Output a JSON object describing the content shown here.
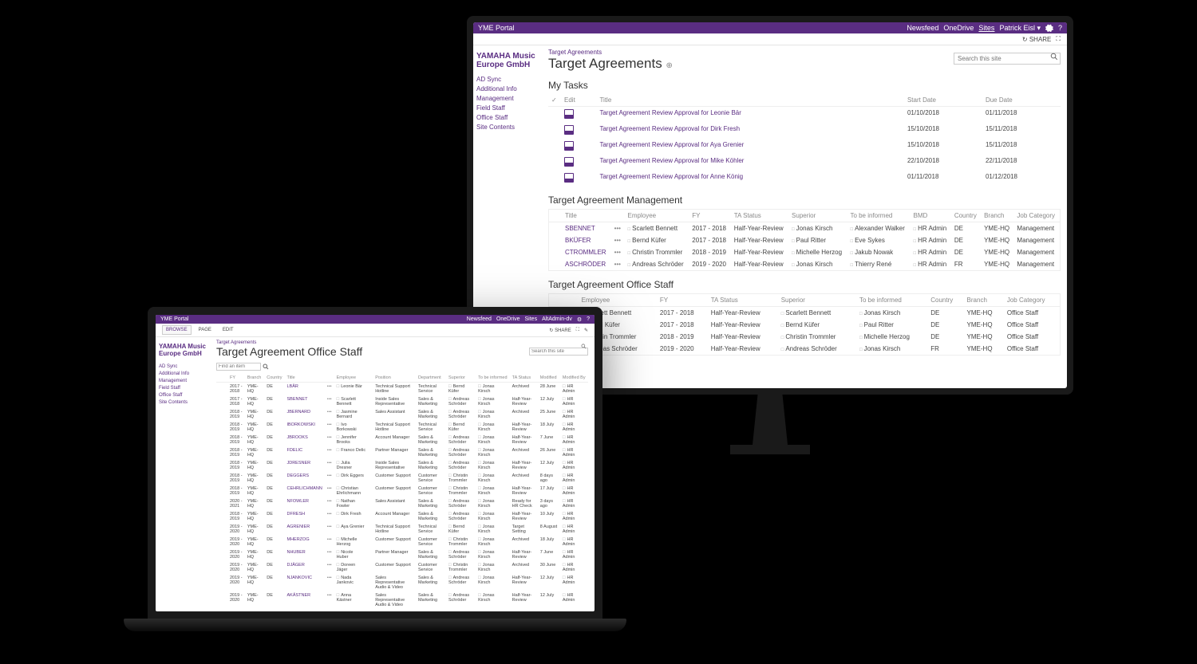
{
  "suite": {
    "brand": "YME Portal",
    "links": [
      "Newsfeed",
      "OneDrive",
      "Sites"
    ],
    "user": "Patrick Eisl",
    "share": "SHARE"
  },
  "ribbon": {
    "browse": "BROWSE",
    "page": "PAGE",
    "edit": "EDIT",
    "altuser": "AltAdmin-dv"
  },
  "logo": {
    "l1": "YAMAHA Music",
    "l2": "Europe GmbH"
  },
  "nav": [
    "AD Sync",
    "Additional Info",
    "Management",
    "Field Staff",
    "Office Staff",
    "Site Contents"
  ],
  "search": {
    "placeholder": "Search this site"
  },
  "monitor": {
    "breadcrumb": "Target Agreements",
    "title": "Target Agreements",
    "myTasks": {
      "heading": "My Tasks",
      "cols": [
        "",
        "Edit",
        "Title",
        "Start Date",
        "Due Date"
      ],
      "rows": [
        {
          "t": "Target Agreement Review Approval for Leonie Bär",
          "s": "01/10/2018",
          "d": "01/11/2018"
        },
        {
          "t": "Target Agreement Review Approval for Dirk Fresh",
          "s": "15/10/2018",
          "d": "15/11/2018"
        },
        {
          "t": "Target Agreement Review Approval for Aya Grenier",
          "s": "15/10/2018",
          "d": "15/11/2018"
        },
        {
          "t": "Target Agreement Review Approval for Mike Köhler",
          "s": "22/10/2018",
          "d": "22/11/2018"
        },
        {
          "t": "Target Agreement Review Approval for Anne König",
          "s": "01/11/2018",
          "d": "01/12/2018"
        }
      ]
    },
    "mgmt": {
      "heading": "Target Agreement Management",
      "cols": [
        "",
        "Title",
        "",
        "Employee",
        "FY",
        "TA Status",
        "Superior",
        "To be informed",
        "BMD",
        "Country",
        "Branch",
        "Job Category"
      ],
      "rows": [
        {
          "ti": "SBENNET",
          "emp": "Scarlett Bennett",
          "fy": "2017 - 2018",
          "st": "Half-Year-Review",
          "sup": "Jonas Kirsch",
          "inf": "Alexander Walker",
          "bmd": "HR Admin",
          "co": "DE",
          "br": "YME-HQ",
          "jc": "Management"
        },
        {
          "ti": "BKÜFER",
          "emp": "Bernd Küfer",
          "fy": "2017 - 2018",
          "st": "Half-Year-Review",
          "sup": "Paul Ritter",
          "inf": "Eve Sykes",
          "bmd": "HR Admin",
          "co": "DE",
          "br": "YME-HQ",
          "jc": "Management"
        },
        {
          "ti": "CTROMMLER",
          "emp": "Christin Trommler",
          "fy": "2018 - 2019",
          "st": "Half-Year-Review",
          "sup": "Michelle Herzog",
          "inf": "Jakub Nowak",
          "bmd": "HR Admin",
          "co": "DE",
          "br": "YME-HQ",
          "jc": "Management"
        },
        {
          "ti": "ASCHRÖDER",
          "emp": "Andreas Schröder",
          "fy": "2019 - 2020",
          "st": "Half-Year-Review",
          "sup": "Jonas Kirsch",
          "inf": "Thierry René",
          "bmd": "HR Admin",
          "co": "FR",
          "br": "YME-HQ",
          "jc": "Management"
        }
      ]
    },
    "office": {
      "heading": "Target Agreement Office Staff",
      "cols": [
        "",
        "",
        "Employee",
        "FY",
        "TA Status",
        "Superior",
        "To be informed",
        "Country",
        "Branch",
        "Job Category"
      ],
      "rows": [
        {
          "emp": "Scarlett Bennett",
          "fy": "2017 - 2018",
          "st": "Half-Year-Review",
          "sup": "Scarlett Bennett",
          "inf": "Jonas Kirsch",
          "co": "DE",
          "br": "YME-HQ",
          "jc": "Office Staff"
        },
        {
          "emp": "Bernd Küfer",
          "fy": "2017 - 2018",
          "st": "Half-Year-Review",
          "sup": "Bernd Küfer",
          "inf": "Paul Ritter",
          "co": "DE",
          "br": "YME-HQ",
          "jc": "Office Staff"
        },
        {
          "emp": "Christin Trommler",
          "fy": "2018 - 2019",
          "st": "Half-Year-Review",
          "sup": "Christin Trommler",
          "inf": "Michelle Herzog",
          "co": "DE",
          "br": "YME-HQ",
          "jc": "Office Staff"
        },
        {
          "emp": "Andreas Schröder",
          "fy": "2019 - 2020",
          "st": "Half-Year-Review",
          "sup": "Andreas Schröder",
          "inf": "Jonas Kirsch",
          "co": "FR",
          "br": "YME-HQ",
          "jc": "Office Staff"
        }
      ]
    }
  },
  "laptop": {
    "breadcrumb": "Target Agreements",
    "title": "Target Agreement Office Staff",
    "findPlaceholder": "Find an item",
    "cols": [
      "",
      "FY",
      "Branch",
      "Country",
      "Title",
      "",
      "Employee",
      "",
      "Position",
      "Department",
      "Superior",
      "To be informed",
      "TA Status",
      "Modified",
      "Modified By"
    ],
    "rows": [
      {
        "fy": "2017 - 2018",
        "br": "YME-HQ",
        "co": "DE",
        "ti": "LBÄR",
        "emp": "Leonie Bär",
        "pos": "Technical Support Hotline",
        "dep": "Technical Service",
        "sup": "Bernd Küfer",
        "inf": "Jonas Kirsch",
        "st": "Archived",
        "mod": "28 June",
        "mby": "HR Admin"
      },
      {
        "fy": "2017 - 2018",
        "br": "YME-HQ",
        "co": "DE",
        "ti": "SBENNET",
        "emp": "Scarlett Bennett",
        "pos": "Inside Sales Representative",
        "dep": "Sales & Marketing",
        "sup": "Andreas Schröder",
        "inf": "Jonas Kirsch",
        "st": "Half-Year-Review",
        "mod": "12 July",
        "mby": "HR Admin"
      },
      {
        "fy": "2018 - 2019",
        "br": "YME-HQ",
        "co": "DE",
        "ti": "JBERNARD",
        "emp": "Jasmine Bernard",
        "pos": "Sales Assistant",
        "dep": "Sales & Marketing",
        "sup": "Andreas Schröder",
        "inf": "Jonas Kirsch",
        "st": "Archived",
        "mod": "25 June",
        "mby": "HR Admin"
      },
      {
        "fy": "2018 - 2019",
        "br": "YME-HQ",
        "co": "DE",
        "ti": "IBORKOWSKI",
        "emp": "Ivo Borkowski",
        "pos": "Technical Support Hotline",
        "dep": "Technical Service",
        "sup": "Bernd Küfer",
        "inf": "Jonas Kirsch",
        "st": "Half-Year-Review",
        "mod": "18 July",
        "mby": "HR Admin"
      },
      {
        "fy": "2018 - 2019",
        "br": "YME-HQ",
        "co": "DE",
        "ti": "JBROOKS",
        "emp": "Jennifer Brooks",
        "pos": "Account Manager",
        "dep": "Sales & Marketing",
        "sup": "Andreas Schröder",
        "inf": "Jonas Kirsch",
        "st": "Half-Year-Review",
        "mod": "7 June",
        "mby": "HR Admin"
      },
      {
        "fy": "2018 - 2019",
        "br": "YME-HQ",
        "co": "DE",
        "ti": "FDELIC",
        "emp": "Franco Delic",
        "pos": "Partner Manager",
        "dep": "Sales & Marketing",
        "sup": "Andreas Schröder",
        "inf": "Jonas Kirsch",
        "st": "Archived",
        "mod": "26 June",
        "mby": "HR Admin"
      },
      {
        "fy": "2018 - 2019",
        "br": "YME-HQ",
        "co": "DE",
        "ti": "JDRESNER",
        "emp": "Julia Dresner",
        "pos": "Inside Sales Representative",
        "dep": "Sales & Marketing",
        "sup": "Andreas Schröder",
        "inf": "Jonas Kirsch",
        "st": "Half-Year-Review",
        "mod": "12 July",
        "mby": "HR Admin"
      },
      {
        "fy": "2018 - 2019",
        "br": "YME-HQ",
        "co": "DE",
        "ti": "DEGGERS",
        "emp": "Dirk Eggers",
        "pos": "Customer Support",
        "dep": "Customer Service",
        "sup": "Christin Trommler",
        "inf": "Jonas Kirsch",
        "st": "Archived",
        "mod": "8 days ago",
        "mby": "HR Admin"
      },
      {
        "fy": "2018 - 2019",
        "br": "YME-HQ",
        "co": "DE",
        "ti": "CEHRLICHMANN",
        "emp": "Christian Ehrlichmann",
        "pos": "Customer Support",
        "dep": "Customer Service",
        "sup": "Christin Trommler",
        "inf": "Jonas Kirsch",
        "st": "Half-Year-Review",
        "mod": "17 July",
        "mby": "HR Admin"
      },
      {
        "fy": "2020 - 2021",
        "br": "YME-HQ",
        "co": "DE",
        "ti": "NFOWLER",
        "emp": "Nathan Fowler",
        "pos": "Sales Assistant",
        "dep": "Sales & Marketing",
        "sup": "Andreas Schröder",
        "inf": "Jonas Kirsch",
        "st": "Ready for HR Check",
        "mod": "3 days ago",
        "mby": "HR Admin"
      },
      {
        "fy": "2018 - 2019",
        "br": "YME-HQ",
        "co": "DE",
        "ti": "DFRESH",
        "emp": "Dirk Fresh",
        "pos": "Account Manager",
        "dep": "Sales & Marketing",
        "sup": "Andreas Schröder",
        "inf": "Jonas Kirsch",
        "st": "Half-Year-Review",
        "mod": "10 July",
        "mby": "HR Admin"
      },
      {
        "fy": "2019 - 2020",
        "br": "YME-HQ",
        "co": "DE",
        "ti": "AGRENIER",
        "emp": "Aya Grenier",
        "pos": "Technical Support Hotline",
        "dep": "Technical Service",
        "sup": "Bernd Küfer",
        "inf": "Jonas Kirsch",
        "st": "Target Setting",
        "mod": "8 August",
        "mby": "HR Admin"
      },
      {
        "fy": "2019 - 2020",
        "br": "YME-HQ",
        "co": "DE",
        "ti": "MHERZOG",
        "emp": "Michelle Herzog",
        "pos": "Customer Support",
        "dep": "Customer Service",
        "sup": "Christin Trommler",
        "inf": "Jonas Kirsch",
        "st": "Archived",
        "mod": "18 July",
        "mby": "HR Admin"
      },
      {
        "fy": "2019 - 2020",
        "br": "YME-HQ",
        "co": "DE",
        "ti": "NHUBER",
        "emp": "Nicole Huber",
        "pos": "Partner Manager",
        "dep": "Sales & Marketing",
        "sup": "Andreas Schröder",
        "inf": "Jonas Kirsch",
        "st": "Half-Year-Review",
        "mod": "7 June",
        "mby": "HR Admin"
      },
      {
        "fy": "2019 - 2020",
        "br": "YME-HQ",
        "co": "DE",
        "ti": "DJÄGER",
        "emp": "Doreen Jäger",
        "pos": "Customer Support",
        "dep": "Customer Service",
        "sup": "Christin Trommler",
        "inf": "Jonas Kirsch",
        "st": "Archived",
        "mod": "30 June",
        "mby": "HR Admin"
      },
      {
        "fy": "2019 - 2020",
        "br": "YME-HQ",
        "co": "DE",
        "ti": "NJANKOVIC",
        "emp": "Nada Jankovic",
        "pos": "Sales Representative Audio & Video",
        "dep": "Sales & Marketing",
        "sup": "Andreas Schröder",
        "inf": "Jonas Kirsch",
        "st": "Half-Year-Review",
        "mod": "12 July",
        "mby": "HR Admin"
      },
      {
        "fy": "2019 - 2020",
        "br": "YME-HQ",
        "co": "DE",
        "ti": "AKÄSTNER",
        "emp": "Anna Kästner",
        "pos": "Sales Representative Audio & Video",
        "dep": "Sales & Marketing",
        "sup": "Andreas Schröder",
        "inf": "Jonas Kirsch",
        "st": "Half-Year-Review",
        "mod": "12 July",
        "mby": "HR Admin"
      }
    ]
  }
}
